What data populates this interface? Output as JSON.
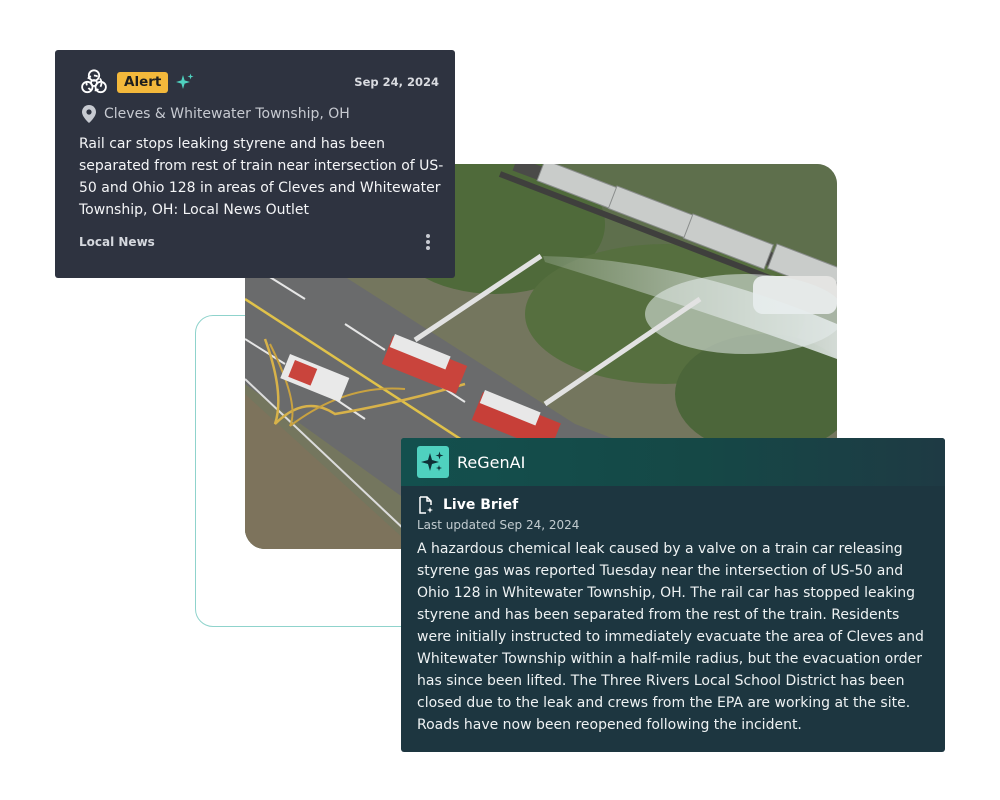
{
  "alert": {
    "badge": "Alert",
    "date": "Sep 24, 2024",
    "location": "Cleves & Whitewater Township, OH",
    "headline": "Rail car stops leaking styrene and has been separated from rest of train near intersection of US-50 and Ohio 128 in areas of Cleves and Whitewater Township, OH: Local News Outlet",
    "source": "Local News"
  },
  "brief": {
    "brand": "ReGenAI",
    "title": "Live Brief",
    "updated": "Last updated Sep 24, 2024",
    "text": "A hazardous chemical leak caused by a valve on a train car releasing styrene gas was reported Tuesday near the intersection of US-50 and Ohio 128 in Whitewater Township, OH. The rail car has stopped leaking styrene and has been separated from the rest of the train. Residents were initially instructed to immediately evacuate the area of Cleves and Whitewater Township within a half-mile radius, but the evacuation order has since been lifted. The Three Rivers Local School District has been closed due to the leak and crews from the EPA are working at the site. Roads have now been reopened following the incident."
  },
  "icons": {
    "alert_type": "biohazard-icon",
    "ai_marker": "sparkle-icon",
    "location": "map-pin-icon",
    "menu": "more-vertical-icon",
    "brief": "document-sparkle-icon"
  },
  "colors": {
    "alert_card_bg": "#2e3340",
    "alert_badge": "#f3b83b",
    "accent_teal": "#4fd1bf",
    "brief_card_bg": "#1d3640",
    "connector": "#8fd3cc"
  }
}
